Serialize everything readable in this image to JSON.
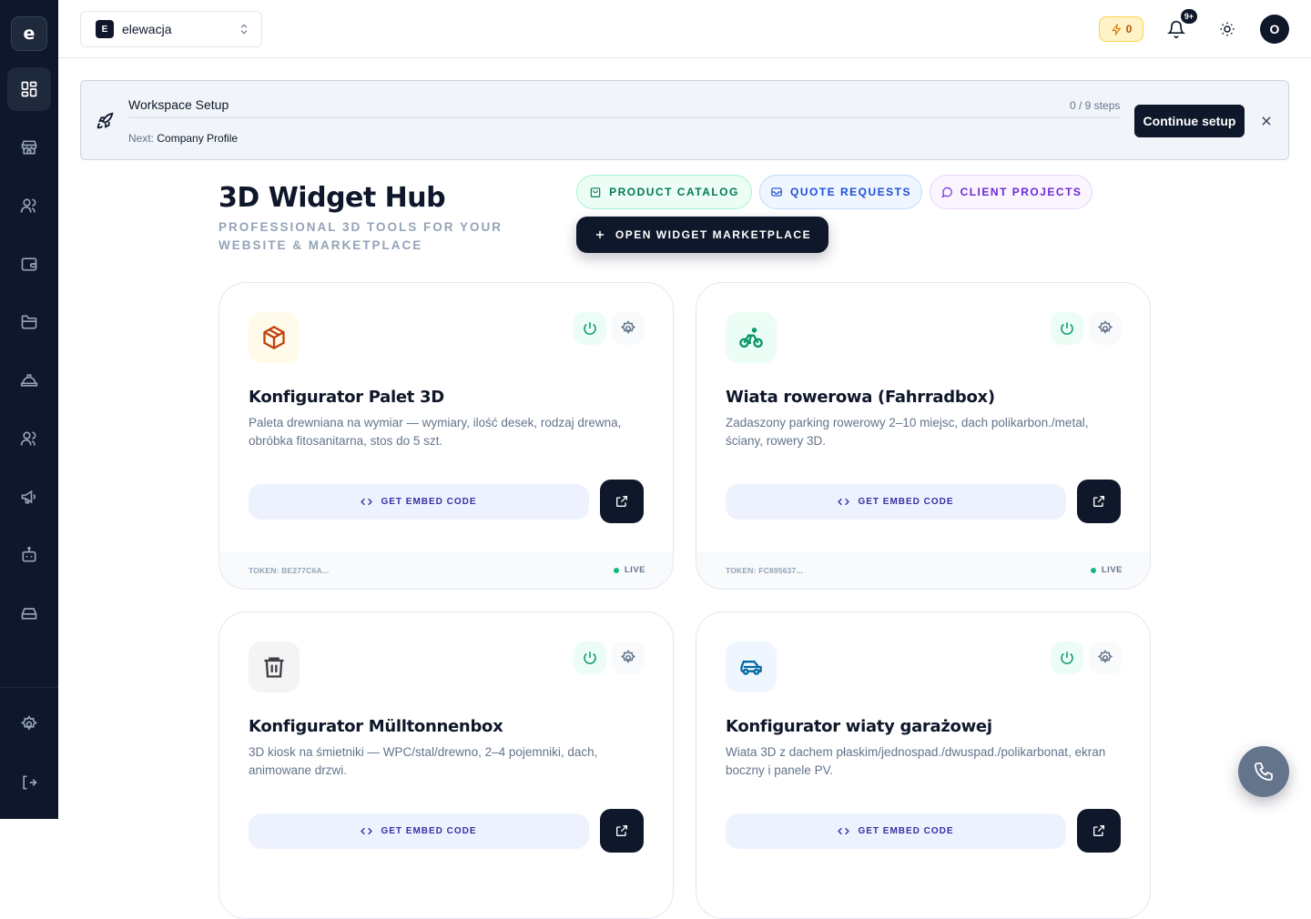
{
  "sidebar": {
    "logo": "e",
    "items": [
      {
        "icon": "dashboard-icon",
        "active": true
      },
      {
        "icon": "store-icon"
      },
      {
        "icon": "users-icon"
      },
      {
        "icon": "wallet-icon"
      },
      {
        "icon": "folder-icon"
      },
      {
        "icon": "helmet-icon"
      },
      {
        "icon": "team-icon"
      },
      {
        "icon": "megaphone-icon"
      },
      {
        "icon": "bot-icon"
      },
      {
        "icon": "drive-icon"
      }
    ],
    "bottom": [
      {
        "icon": "settings-icon"
      },
      {
        "icon": "logout-icon"
      }
    ]
  },
  "topbar": {
    "workspace_badge": "E",
    "workspace_name": "elewacja",
    "credits": "0",
    "notifications_badge": "9+",
    "avatar": "O"
  },
  "setup": {
    "title": "Workspace Setup",
    "steps": "0 / 9 steps",
    "progress": 0,
    "next_label": "Next:",
    "next_value": "Company Profile",
    "button": "Continue setup"
  },
  "hub": {
    "title": "3D Widget Hub",
    "subtitle": "PROFESSIONAL 3D TOOLS FOR YOUR WEBSITE & MARKETPLACE",
    "pills": [
      "PRODUCT CATALOG",
      "QUOTE REQUESTS",
      "CLIENT PROJECTS"
    ],
    "marketplace": "OPEN WIDGET MARKETPLACE"
  },
  "cards": [
    {
      "icon": "package-icon",
      "title": "Konfigurator Palet 3D",
      "desc": "Paleta drewniana na wymiar — wymiary, ilość desek, rodzaj drewna, obróbka fitosanitarna, stos do 5 szt.",
      "embed": "GET EMBED CODE",
      "token": "TOKEN: BE277C6A...",
      "status": "LIVE"
    },
    {
      "icon": "bike-icon",
      "title": "Wiata rowerowa (Fahrradbox)",
      "desc": "Zadaszony parking rowerowy 2–10 miejsc, dach polikarbon./metal, ściany, rowery 3D.",
      "embed": "GET EMBED CODE",
      "token": "TOKEN: FC895637...",
      "status": "LIVE"
    },
    {
      "icon": "trash-icon",
      "title": "Konfigurator Mülltonnenbox",
      "desc": "3D kiosk na śmietniki — WPC/stal/drewno, 2–4 pojemniki, dach, animowane drzwi.",
      "embed": "GET EMBED CODE",
      "token": "",
      "status": ""
    },
    {
      "icon": "car-icon",
      "title": "Konfigurator wiaty garażowej",
      "desc": "Wiata 3D z dachem płaskim/jednospad./dwuspad./polikarbonat, ekran boczny i panele PV.",
      "embed": "GET EMBED CODE",
      "token": "",
      "status": ""
    }
  ],
  "colors": {
    "sidebar": "#0f172a",
    "accent": "#0f172a",
    "live": "#10b981"
  }
}
